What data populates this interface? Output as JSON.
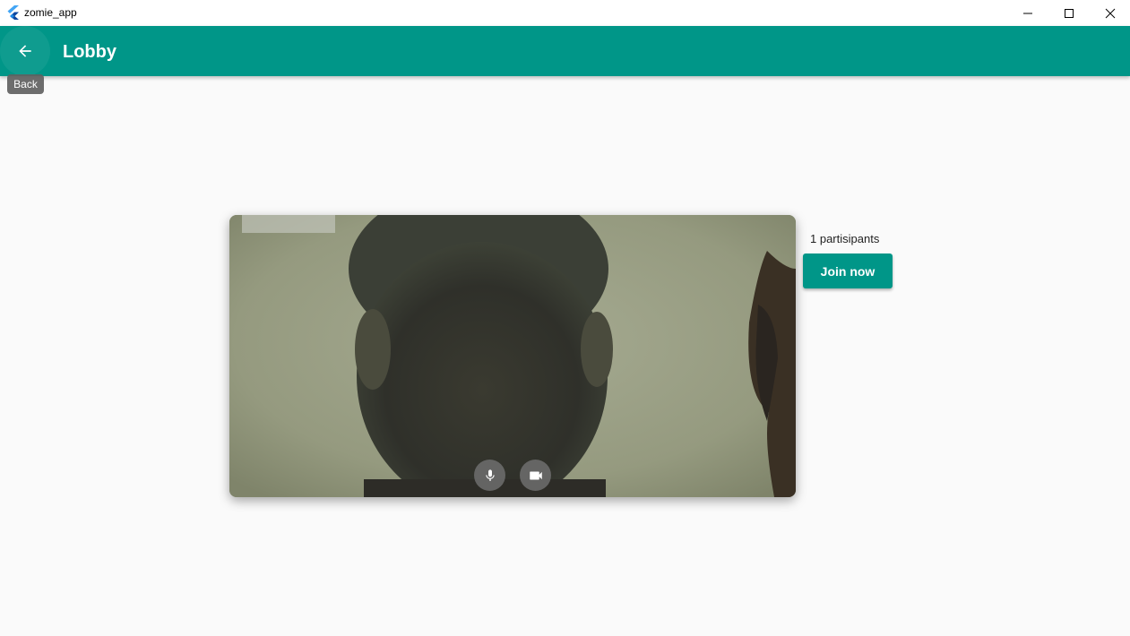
{
  "window": {
    "title": "zomie_app",
    "minimize_icon": "minimize-icon",
    "maximize_icon": "maximize-icon",
    "close_icon": "close-icon"
  },
  "appbar": {
    "title": "Lobby",
    "back_icon": "arrow-back-icon",
    "back_tooltip": "Back",
    "color": "#009688"
  },
  "video": {
    "mic_icon": "mic-icon",
    "camera_icon": "videocam-icon"
  },
  "lobby": {
    "participants_text": "1 partisipants",
    "join_label": "Join now"
  }
}
